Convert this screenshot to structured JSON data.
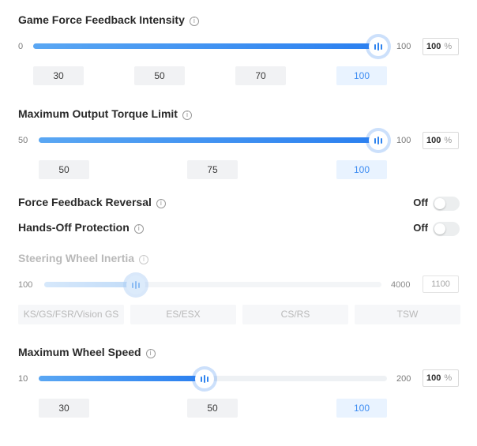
{
  "sections": {
    "game_ffb": {
      "title": "Game Force Feedback Intensity",
      "min": "0",
      "max": "100",
      "value": "100",
      "unit": "%",
      "level": 1.0,
      "presets": [
        "30",
        "50",
        "70",
        "100"
      ],
      "active_preset": "100"
    },
    "max_torque": {
      "title": "Maximum Output Torque Limit",
      "min": "50",
      "max": "100",
      "value": "100",
      "unit": "%",
      "level": 1.0,
      "presets": [
        "50",
        "75",
        "100"
      ],
      "active_preset": "100"
    },
    "ffb_reversal": {
      "title": "Force Feedback Reversal",
      "state": "Off"
    },
    "hands_off": {
      "title": "Hands-Off Protection",
      "state": "Off"
    },
    "inertia": {
      "title": "Steering Wheel Inertia",
      "min": "100",
      "max": "4000",
      "value": "1100",
      "level": 0.25,
      "presets": [
        "KS/GS/FSR/Vision GS",
        "ES/ESX",
        "CS/RS",
        "TSW"
      ],
      "disabled": true
    },
    "wheel_speed": {
      "title": "Maximum Wheel Speed",
      "min": "10",
      "max": "200",
      "value": "100",
      "unit": "%",
      "level": 0.47,
      "presets": [
        "30",
        "50",
        "100"
      ],
      "active_preset": "100"
    }
  },
  "icons": {
    "info": "info-icon",
    "thumb": "slider-grip-icon"
  },
  "colors": {
    "accent": "#2a7ff0",
    "accent_light": "#e9f3ff",
    "preset_bg": "#f1f2f4"
  }
}
